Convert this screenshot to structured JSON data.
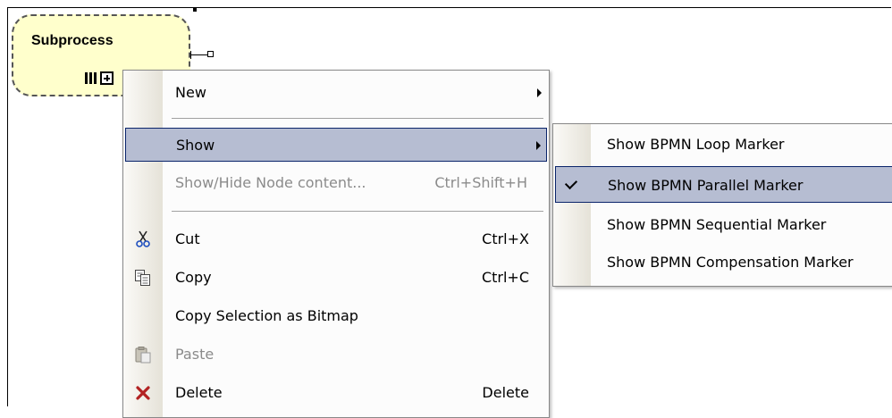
{
  "node": {
    "title": "Subprocess",
    "markers": [
      "parallel-marker",
      "expand-plus-icon"
    ]
  },
  "context_menu": {
    "items": [
      {
        "label": "New",
        "shortcut": "",
        "submenu": true,
        "disabled": false,
        "icon": ""
      },
      {
        "label": "Show",
        "shortcut": "",
        "submenu": true,
        "disabled": false,
        "icon": "",
        "highlighted": true
      },
      {
        "label": "Show/Hide Node content...",
        "shortcut": "Ctrl+Shift+H",
        "submenu": false,
        "disabled": true,
        "icon": ""
      },
      {
        "label": "Cut",
        "shortcut": "Ctrl+X",
        "submenu": false,
        "disabled": false,
        "icon": "scissors-icon"
      },
      {
        "label": "Copy",
        "shortcut": "Ctrl+C",
        "submenu": false,
        "disabled": false,
        "icon": "copy-icon"
      },
      {
        "label": "Copy Selection as Bitmap",
        "shortcut": "",
        "submenu": false,
        "disabled": false,
        "icon": ""
      },
      {
        "label": "Paste",
        "shortcut": "",
        "submenu": false,
        "disabled": true,
        "icon": "paste-icon"
      },
      {
        "label": "Delete",
        "shortcut": "Delete",
        "submenu": false,
        "disabled": false,
        "icon": "delete-icon"
      }
    ]
  },
  "show_submenu": {
    "items": [
      {
        "label": "Show BPMN Loop Marker",
        "checked": false
      },
      {
        "label": "Show BPMN Parallel Marker",
        "checked": true,
        "highlighted": true
      },
      {
        "label": "Show BPMN Sequential Marker",
        "checked": false
      },
      {
        "label": "Show BPMN Compensation Marker",
        "checked": false
      }
    ]
  },
  "colors": {
    "node_fill": "#ffffcc",
    "highlight": "#b6bdd2",
    "highlight_border": "#0a246a",
    "disabled_text": "#8b8b8b",
    "delete_icon": "#b22222"
  }
}
